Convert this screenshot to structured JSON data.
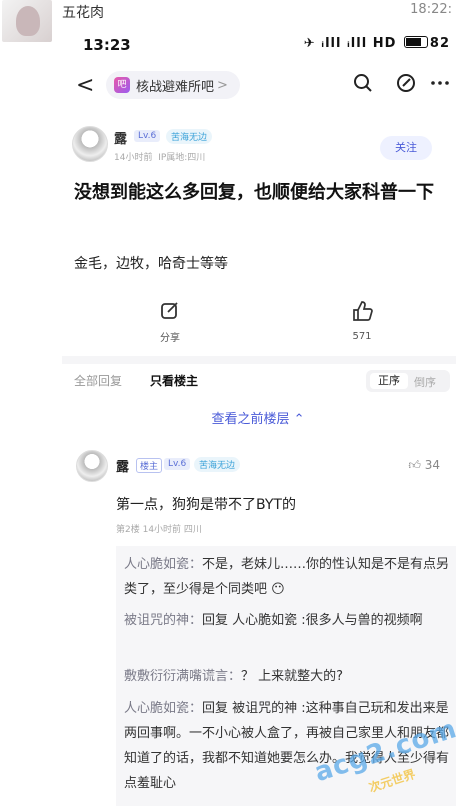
{
  "outer": {
    "name": "五花肉",
    "time": "18:22:"
  },
  "status": {
    "time": "13:23",
    "right": "✈ ᵢlll ᵢlll HD",
    "battery": "82"
  },
  "nav": {
    "forum": "核战避难所吧",
    "chev": ">",
    "back": "<",
    "forum_logo": "吧"
  },
  "post": {
    "author": "露",
    "level": "Lv.6",
    "medal": "苦海无边",
    "time": "14小时前",
    "location": "IP属地:四川",
    "follow": "关注",
    "title": "没想到能这么多回复，也顺便给大家科普一下",
    "body": "金毛，边牧，哈奇士等等",
    "share_label": "分享",
    "likes": "571"
  },
  "tabs": {
    "all": "全部回复",
    "host_only": "只看楼主",
    "asc": "正序",
    "desc": "倒序"
  },
  "prev_floors": "查看之前楼层 ⌃",
  "reply": {
    "author": "露",
    "host_badge": "楼主",
    "level": "Lv.6",
    "medal": "苦海无边",
    "likes": "34",
    "text": "第一点，狗狗是带不了BYT的",
    "meta": "第2楼  14小时前  四川"
  },
  "sub_replies": [
    {
      "name": "人心脆如瓷：",
      "text": "不是，老妹儿……你的性认知是不是有点另类了，至少得是个同类吧 😶"
    },
    {
      "name": "被诅咒的神：",
      "text": "回复 人心脆如瓷 :很多人与兽的视频啊"
    },
    {
      "name": "敷敷衍衍满嘴谎言：",
      "text": "？  上来就整大的?"
    },
    {
      "name": "人心脆如瓷：",
      "text": "回复 被诅咒的神 :这种事自己玩和发出来是两回事啊。一不小心被人盒了，再被自己家里人和朋友都知道了的话，我都不知道她要怎么办。我觉得人至少得有点羞耻心"
    }
  ],
  "watermark": {
    "main": "acg2.com",
    "sub": "次元世界"
  }
}
